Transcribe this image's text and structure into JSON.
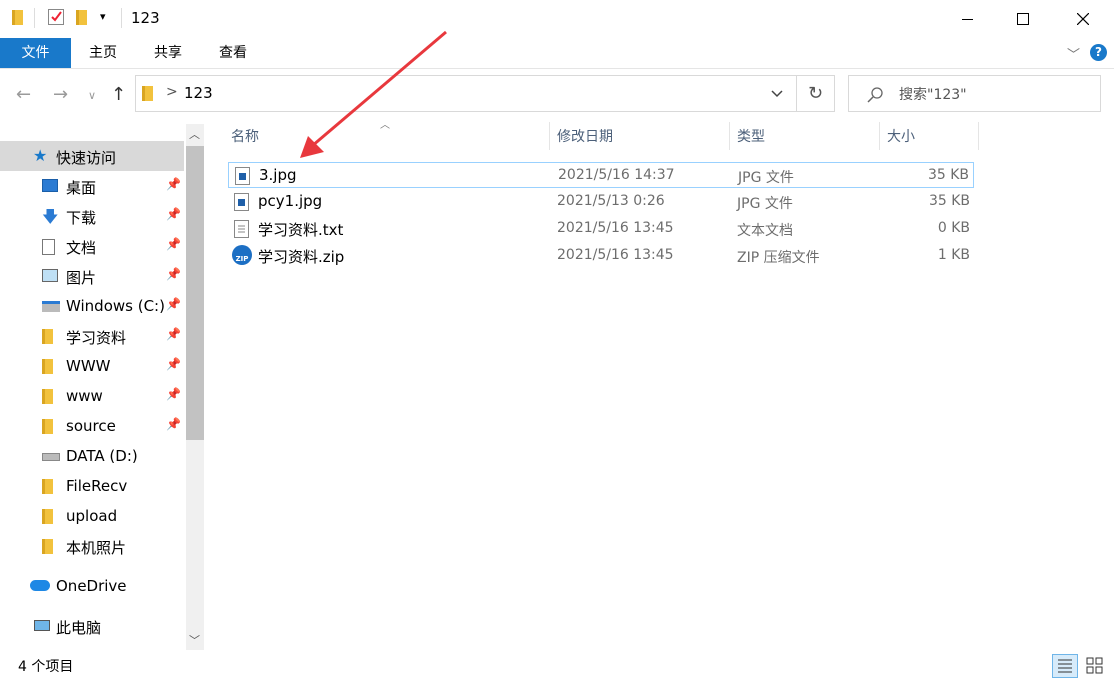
{
  "title": "123",
  "ribbon_tabs": [
    "文件",
    "主页",
    "共享",
    "查看"
  ],
  "address": {
    "crumb_separator": ">",
    "path": "123"
  },
  "search": {
    "placeholder": "搜索\"123\""
  },
  "nav": {
    "quick_access": "快速访问",
    "items": [
      {
        "label": "桌面",
        "icon": "desktop-icon",
        "pinned": true
      },
      {
        "label": "下载",
        "icon": "download-arrow-icon",
        "pinned": true
      },
      {
        "label": "文档",
        "icon": "document-icon",
        "pinned": true
      },
      {
        "label": "图片",
        "icon": "picture-icon",
        "pinned": true
      },
      {
        "label": "Windows (C:)",
        "icon": "windows-drive-icon",
        "pinned": true
      },
      {
        "label": "学习资料",
        "icon": "folder-icon",
        "pinned": true
      },
      {
        "label": "WWW",
        "icon": "folder-icon",
        "pinned": true
      },
      {
        "label": "www",
        "icon": "folder-icon",
        "pinned": true
      },
      {
        "label": "source",
        "icon": "folder-icon",
        "pinned": true
      },
      {
        "label": "DATA (D:)",
        "icon": "drive-icon",
        "pinned": false
      },
      {
        "label": "FileRecv",
        "icon": "folder-icon",
        "pinned": false
      },
      {
        "label": "upload",
        "icon": "folder-icon",
        "pinned": false
      },
      {
        "label": "本机照片",
        "icon": "folder-icon",
        "pinned": false
      }
    ],
    "onedrive": "OneDrive",
    "this_pc": "此电脑"
  },
  "columns": {
    "name": "名称",
    "date": "修改日期",
    "type": "类型",
    "size": "大小"
  },
  "files": [
    {
      "name": "3.jpg",
      "date": "2021/5/16 14:37",
      "type": "JPG 文件",
      "size": "35 KB",
      "icon": "jpg-file-icon"
    },
    {
      "name": "pcy1.jpg",
      "date": "2021/5/13 0:26",
      "type": "JPG 文件",
      "size": "35 KB",
      "icon": "jpg-file-icon"
    },
    {
      "name": "学习资料.txt",
      "date": "2021/5/16 13:45",
      "type": "文本文档",
      "size": "0 KB",
      "icon": "txt-file-icon"
    },
    {
      "name": "学习资料.zip",
      "date": "2021/5/16 13:45",
      "type": "ZIP 压缩文件",
      "size": "1 KB",
      "icon": "zip-file-icon"
    }
  ],
  "status": {
    "count": "4 个项目"
  },
  "colors": {
    "accent": "#1979ca",
    "selected_border": "#99d1ff",
    "annotation_arrow": "#e8383d"
  }
}
